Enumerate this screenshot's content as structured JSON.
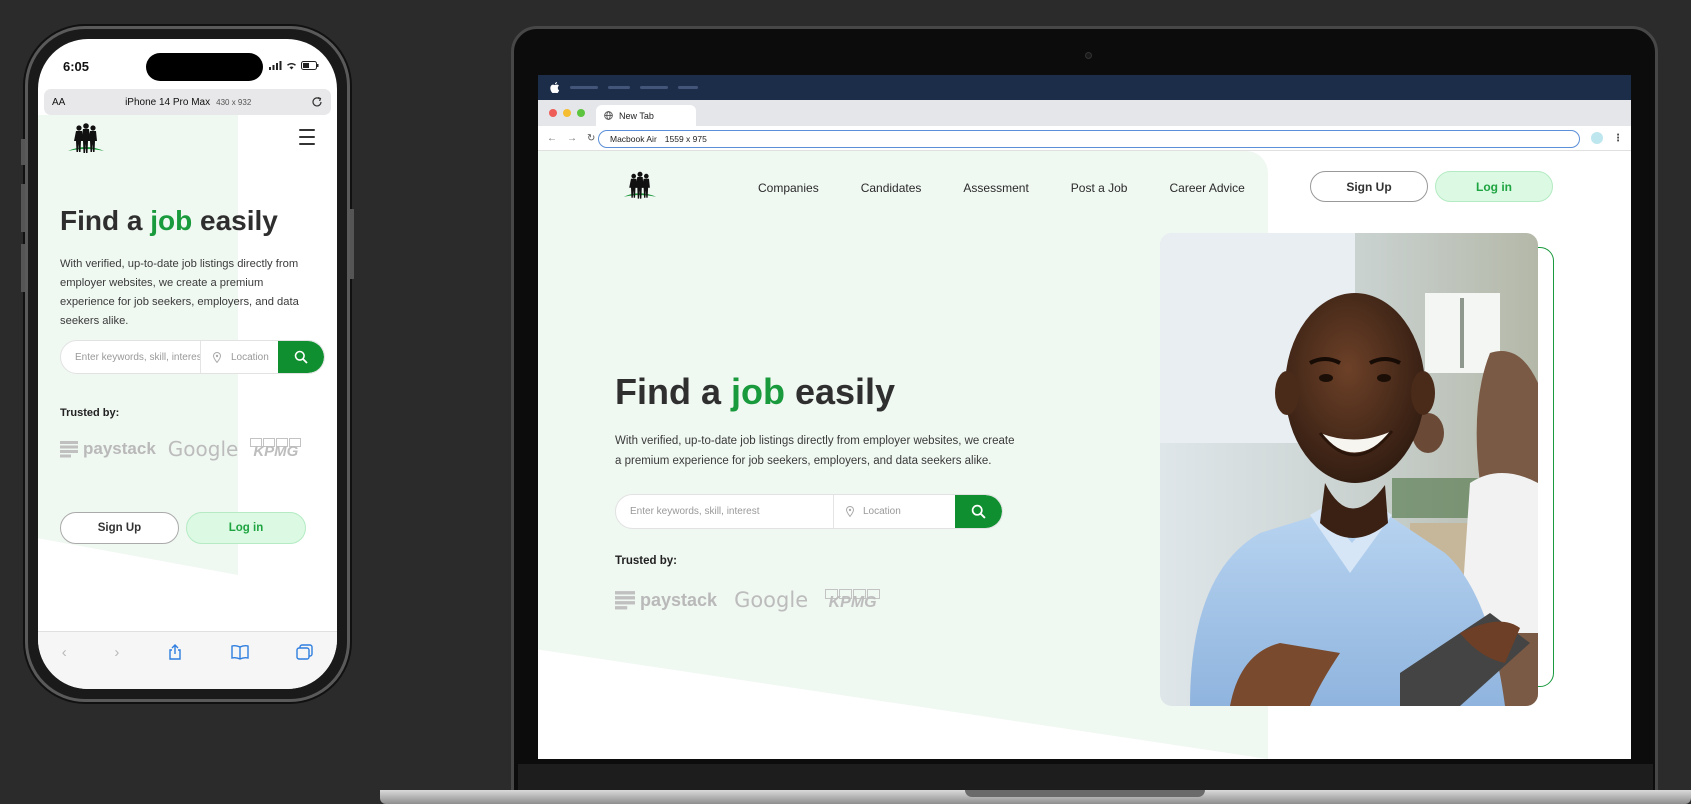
{
  "phone": {
    "time": "6:05",
    "url_title": "iPhone 14 Pro Max",
    "url_dims": "430 x 932",
    "text_size_label": "AA"
  },
  "laptop": {
    "label": "MacBook Air",
    "tab_title": "New Tab",
    "url_title": "Macbook Air",
    "url_dims": "1559 x 975"
  },
  "site": {
    "nav": [
      "Companies",
      "Candidates",
      "Assessment",
      "Post a Job",
      "Career Advice"
    ],
    "signup_label": "Sign Up",
    "login_label": "Log in",
    "hero_title_pre": "Find a ",
    "hero_title_accent": "job",
    "hero_title_post": " easily",
    "hero_desc": "With verified, up-to-date job listings directly from employer websites, we create a premium experience for job seekers, employers, and data seekers alike.",
    "search_placeholder": "Enter keywords, skill, interest",
    "location_placeholder": "Location",
    "trusted_label": "Trusted by:",
    "partners": [
      "paystack",
      "Google",
      "KPMG"
    ]
  },
  "colors": {
    "accent_green": "#199a3c",
    "button_green": "#0f8f2f",
    "login_bg": "#dcf9e3",
    "hero_bg": "#f0f8f2",
    "menubar": "#1c2d4a"
  }
}
